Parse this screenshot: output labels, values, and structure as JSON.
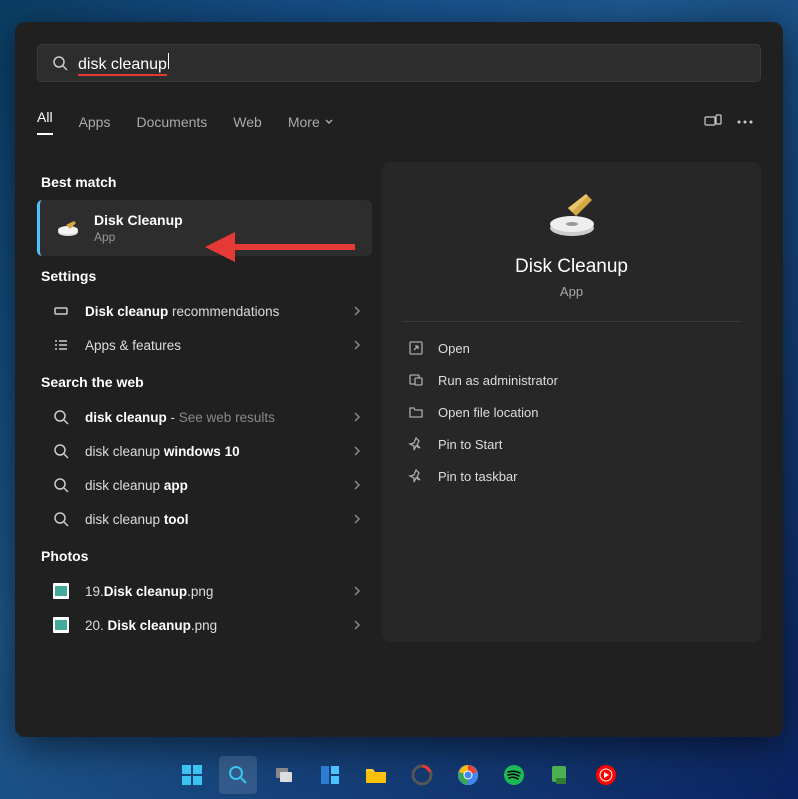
{
  "search": {
    "query": "disk cleanup"
  },
  "tabs": [
    "All",
    "Apps",
    "Documents",
    "Web",
    "More"
  ],
  "sections": {
    "best_match": "Best match",
    "settings": "Settings",
    "search_web": "Search the web",
    "photos": "Photos"
  },
  "best_match": {
    "title": "Disk Cleanup",
    "subtitle": "App"
  },
  "settings_items": [
    {
      "pre": "",
      "bold": "Disk cleanup",
      "post": " recommendations",
      "icon": "rect"
    },
    {
      "pre": "Apps & features",
      "bold": "",
      "post": "",
      "icon": "list"
    }
  ],
  "web_items": [
    {
      "bold": "disk cleanup",
      "post": " - ",
      "dim": "See web results"
    },
    {
      "pre": "disk cleanup ",
      "bold": "windows 10",
      "post": ""
    },
    {
      "pre": "disk cleanup ",
      "bold": "app",
      "post": ""
    },
    {
      "pre": "disk cleanup ",
      "bold": "tool",
      "post": ""
    }
  ],
  "photo_items": [
    {
      "pre": "19.",
      "bold": "Disk cleanup",
      "post": ".png"
    },
    {
      "pre": "20. ",
      "bold": "Disk cleanup",
      "post": ".png"
    }
  ],
  "details": {
    "title": "Disk Cleanup",
    "subtitle": "App",
    "actions": [
      "Open",
      "Run as administrator",
      "Open file location",
      "Pin to Start",
      "Pin to taskbar"
    ]
  }
}
